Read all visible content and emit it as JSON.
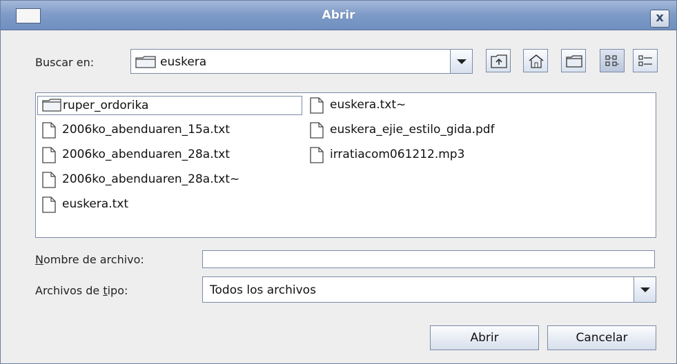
{
  "dialog": {
    "title": "Abrir",
    "close_glyph": "x"
  },
  "look_in": {
    "label": "Buscar en:",
    "value": "euskera",
    "icon": "folder-icon"
  },
  "toolbar": {
    "buttons": [
      {
        "name": "up-folder-button",
        "icon": "up-folder-icon"
      },
      {
        "name": "home-button",
        "icon": "home-icon"
      },
      {
        "name": "new-folder-button",
        "icon": "new-folder-icon"
      },
      {
        "name": "list-view-button",
        "icon": "list-view-icon",
        "active": true
      },
      {
        "name": "details-view-button",
        "icon": "details-view-icon"
      }
    ]
  },
  "files": {
    "column1": [
      {
        "name": "ruper_ordorika",
        "type": "folder",
        "selected": true
      },
      {
        "name": "2006ko_abenduaren_15a.txt",
        "type": "file"
      },
      {
        "name": "2006ko_abenduaren_28a.txt",
        "type": "file"
      },
      {
        "name": "2006ko_abenduaren_28a.txt~",
        "type": "file"
      },
      {
        "name": "euskera.txt",
        "type": "file"
      }
    ],
    "column2": [
      {
        "name": "euskera.txt~",
        "type": "file"
      },
      {
        "name": "euskera_ejie_estilo_gida.pdf",
        "type": "file"
      },
      {
        "name": "irratiacom061212.mp3",
        "type": "file"
      }
    ]
  },
  "filename": {
    "label_mnemonic": "N",
    "label_rest": "ombre de archivo:",
    "value": ""
  },
  "filetype": {
    "label_before": "Archivos de ",
    "label_mnemonic": "t",
    "label_after": "ipo:",
    "value": "Todos los archivos"
  },
  "actions": {
    "open_label": "Abrir",
    "cancel_label": "Cancelar"
  }
}
